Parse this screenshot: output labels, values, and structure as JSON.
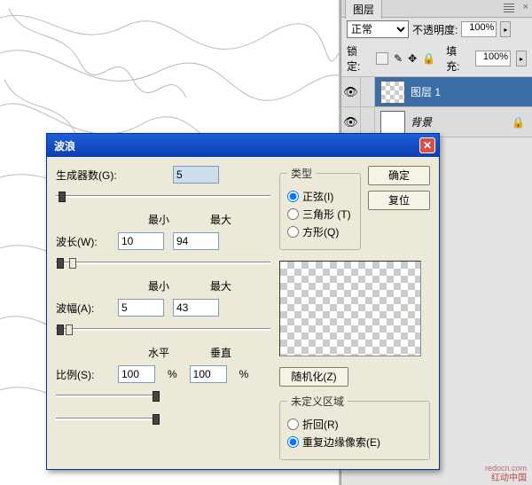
{
  "layers_panel": {
    "tab": "图层",
    "blend_mode": "正常",
    "opacity_label": "不透明度:",
    "opacity_value": "100%",
    "lock_label": "锁定:",
    "fill_label": "填充:",
    "fill_value": "100%",
    "items": [
      {
        "name": "图层 1",
        "selected": true,
        "thumb": "checker"
      },
      {
        "name": "背景",
        "selected": false,
        "thumb": "white",
        "locked": true
      }
    ]
  },
  "dialog": {
    "title": "波浪",
    "generators_label": "生成器数(G):",
    "generators_value": "5",
    "min_header": "最小",
    "max_header": "最大",
    "wavelength_label": "波长(W):",
    "wavelength_min": "10",
    "wavelength_max": "94",
    "amplitude_label": "波幅(A):",
    "amplitude_min": "5",
    "amplitude_max": "43",
    "horiz_header": "水平",
    "vert_header": "垂直",
    "scale_label": "比例(S):",
    "scale_h": "100",
    "scale_v": "100",
    "pct": "%",
    "type_legend": "类型",
    "type_sine": "正弦(I)",
    "type_tri": "三角形 (T)",
    "type_square": "方形(Q)",
    "ok": "确定",
    "reset": "复位",
    "randomize": "随机化(Z)",
    "undef_legend": "未定义区域",
    "undef_wrap": "折回(R)",
    "undef_repeat": "重复边缘像索(E)"
  },
  "watermark": "redocn.com",
  "watermark2": "红动中国"
}
